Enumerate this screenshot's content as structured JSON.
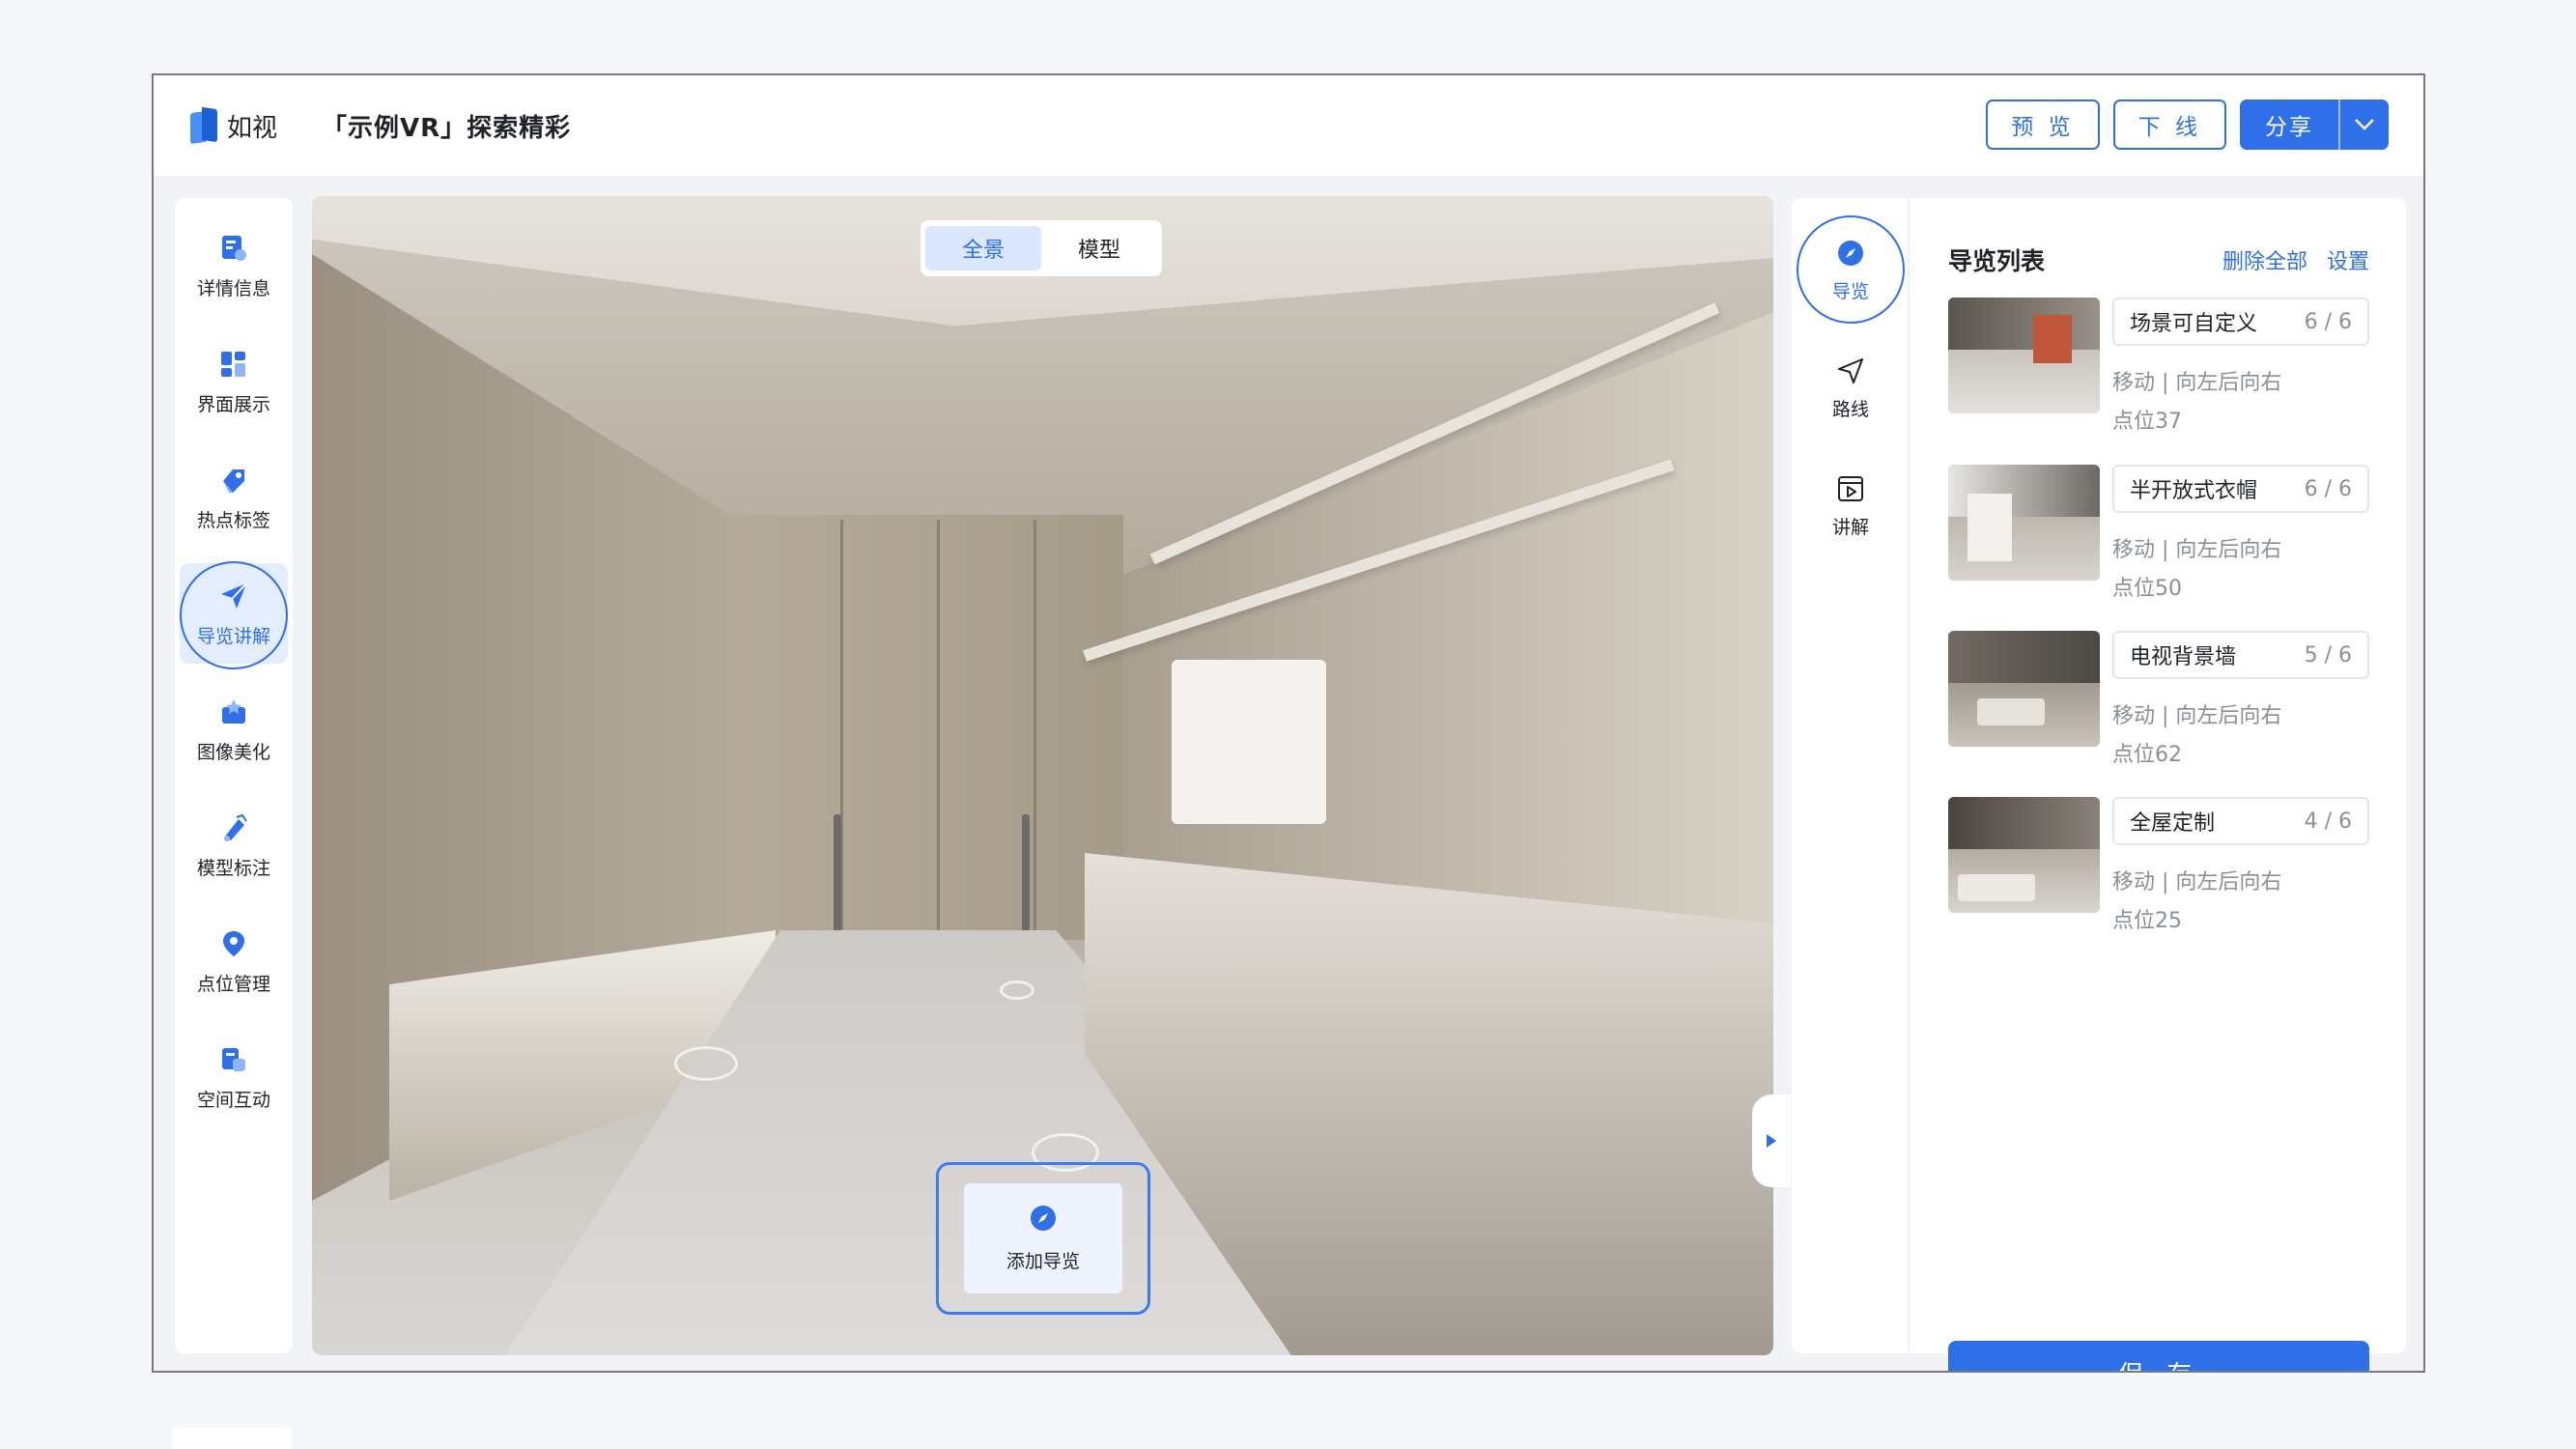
{
  "brand": {
    "logo_text": "如视",
    "colors": {
      "accent": "#2f6fe8",
      "accent_light": "#e4edfd"
    }
  },
  "header": {
    "project_title": "「示例VR」探索精彩",
    "preview_label": "预 览",
    "offline_label": "下 线",
    "share_label": "分享"
  },
  "leftnav": {
    "items": [
      {
        "label": "详情信息",
        "icon": "detail-info-icon"
      },
      {
        "label": "界面展示",
        "icon": "layout-display-icon"
      },
      {
        "label": "热点标签",
        "icon": "hotspot-tag-icon"
      },
      {
        "label": "导览讲解",
        "icon": "tour-guide-icon",
        "active": true
      },
      {
        "label": "图像美化",
        "icon": "image-beautify-icon"
      },
      {
        "label": "模型标注",
        "icon": "model-annotation-icon"
      },
      {
        "label": "点位管理",
        "icon": "location-pin-icon"
      },
      {
        "label": "空间互动",
        "icon": "space-interaction-icon"
      }
    ]
  },
  "viewport": {
    "toggle": {
      "panorama": "全景",
      "model": "模型",
      "selected": "全景"
    },
    "add_tour_label": "添加导览"
  },
  "tools": {
    "items": [
      {
        "label": "导览",
        "icon": "compass-icon",
        "active": true
      },
      {
        "label": "路线",
        "icon": "send-route-icon"
      },
      {
        "label": "讲解",
        "icon": "play-explain-icon"
      }
    ]
  },
  "tour_list": {
    "title": "导览列表",
    "delete_all": "删除全部",
    "settings": "设置",
    "items": [
      {
        "name": "场景可自定义",
        "count": "6 / 6",
        "move": "移动 | 向左后向右",
        "point": "点位37"
      },
      {
        "name": "半开放式衣帽",
        "count": "6 / 6",
        "move": "移动 | 向左后向右",
        "point": "点位50"
      },
      {
        "name": "电视背景墙",
        "count": "5 / 6",
        "move": "移动 | 向左后向右",
        "point": "点位62"
      },
      {
        "name": "全屋定制",
        "count": "4 / 6",
        "move": "移动 | 向左后向右",
        "point": "点位25"
      }
    ],
    "save_label": "保 存"
  }
}
